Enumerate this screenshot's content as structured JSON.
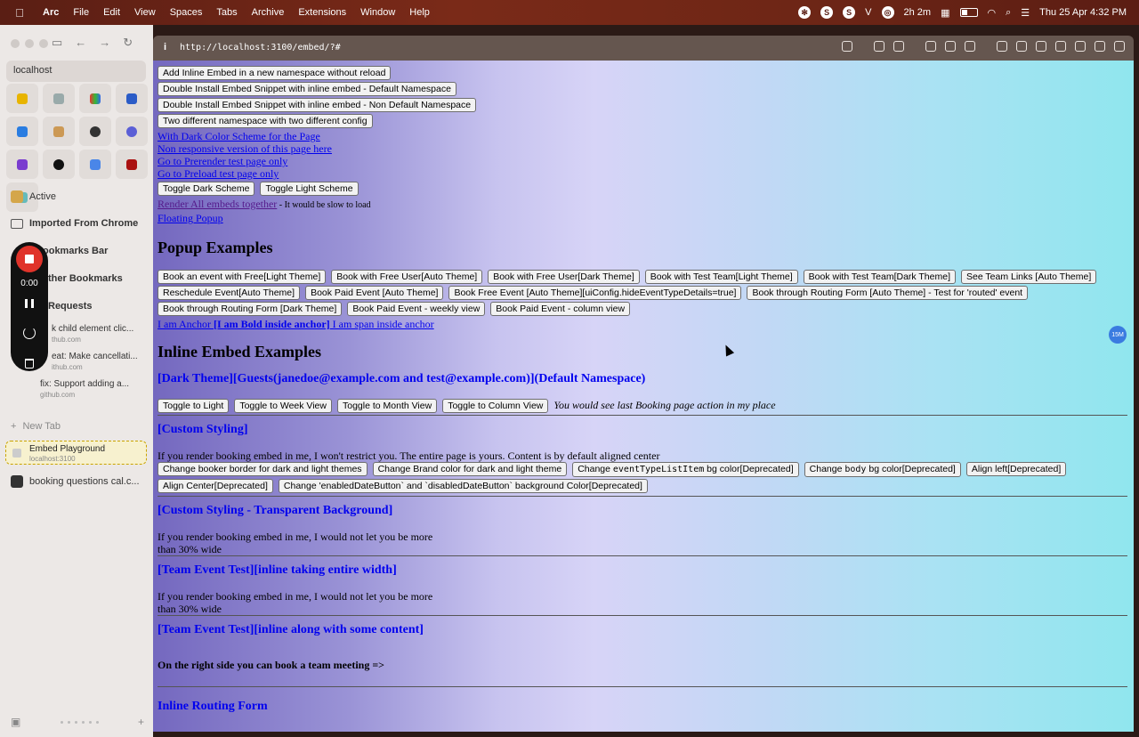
{
  "menubar": {
    "app": "Arc",
    "menus": [
      "File",
      "Edit",
      "View",
      "Spaces",
      "Tabs",
      "Archive",
      "Extensions",
      "Window",
      "Help"
    ],
    "status": {
      "timer": "2h 2m",
      "datetime": "Thu 25 Apr  4:32 PM",
      "v_label": "V"
    }
  },
  "sidebar": {
    "address": "localhost",
    "items": {
      "active": "Active",
      "imported": "Imported From Chrome",
      "bookmarks_bar": "ookmarks Bar",
      "other_bookmarks": "ther Bookmarks",
      "requests": "Requests"
    },
    "tabs": [
      {
        "title": "k child element clic...",
        "sub": "thub.com"
      },
      {
        "title": "eat: Make cancellati...",
        "sub": "ithub.com"
      },
      {
        "title": "fix: Support adding a...",
        "sub": "github.com"
      }
    ],
    "new_tab": "New Tab",
    "active_tab": {
      "title": "Embed Playground",
      "sub": "localhost:3100"
    },
    "other_tab": "booking questions cal.c..."
  },
  "recorder": {
    "time": "0:00"
  },
  "toolbar": {
    "info": "i",
    "url": "http://localhost:3100/embed/?#"
  },
  "content": {
    "top_buttons": [
      "Add Inline Embed in a new namespace without reload",
      "Double Install Embed Snippet with inline embed - Default Namespace",
      "Double Install Embed Snippet with inline embed - Non Default Namespace",
      "Two different namespace with two different config"
    ],
    "links": [
      "With Dark Color Scheme for the Page",
      "Non responsive version of this page here",
      "Go to Prerender test page only",
      "Go to Preload test page only"
    ],
    "scheme_buttons": [
      "Toggle Dark Scheme",
      "Toggle Light Scheme"
    ],
    "render_all_link": "Render All embeds together",
    "render_all_note": " - It would be slow to load",
    "floating_popup": "Floating Popup",
    "popup_heading": "Popup Examples",
    "popup_buttons_row1": [
      "Book an event with Free[Light Theme]",
      "Book with Free User[Auto Theme]",
      "Book with Free User[Dark Theme]",
      "Book with Test Team[Light Theme]",
      "Book with Test Team[Dark Theme]",
      "See Team Links [Auto Theme]"
    ],
    "popup_buttons_row2": [
      "Reschedule Event[Auto Theme]",
      "Book Paid Event [Auto Theme]",
      "Book Free Event [Auto Theme][uiConfig.hideEventTypeDetails=true]",
      "Book through Routing Form [Auto Theme] - Test for 'routed' event"
    ],
    "popup_buttons_row3": [
      "Book through Routing Form [Dark Theme]",
      "Book Paid Event - weekly view",
      "Book Paid Event - column view"
    ],
    "anchor": {
      "start": "I am Anchor ",
      "bold": "[I am Bold inside anchor]",
      "span": " I am span inside anchor"
    },
    "inline_heading": "Inline Embed Examples",
    "dark_theme_heading": "[Dark Theme][Guests(janedoe@example.com and test@example.com)](Default Namespace)",
    "view_buttons": [
      "Toggle to Light",
      "Toggle to Week View",
      "Toggle to Month View",
      "Toggle to Column View"
    ],
    "view_note": "You would see last Booking page action in my place",
    "custom_heading": "[Custom Styling]",
    "custom_para": "If you render booking embed in me, I won't restrict you. The entire page is yours. Content is by default aligned center",
    "custom_buttons_row1": {
      "b1": "Change booker border for dark and light themes",
      "b2": "Change Brand color for dark and light theme",
      "b3_pre": "Change ",
      "b3_code": "eventTypeListItem",
      "b3_post": " bg color[Deprecated]",
      "b4_pre": "Change ",
      "b4_code": "body",
      "b4_post": " bg color[Deprecated]",
      "b5": "Align left[Deprecated]"
    },
    "custom_buttons_row2": [
      "Align Center[Deprecated]",
      "Change 'enabledDateButton` and `disabledDateButton` background Color[Deprecated]"
    ],
    "transparent_heading": "[Custom Styling - Transparent Background]",
    "restrict_line1": "If you render booking embed in me, I would not let you be more",
    "restrict_line2": "than 30% wide",
    "team_full_heading": "[Team Event Test][inline taking entire width]",
    "team_content_heading": "[Team Event Test][inline along with some content]",
    "team_note": "On the right side you can book a team meeting =>",
    "routing_heading": "Inline Routing Form"
  },
  "badge": "15M"
}
